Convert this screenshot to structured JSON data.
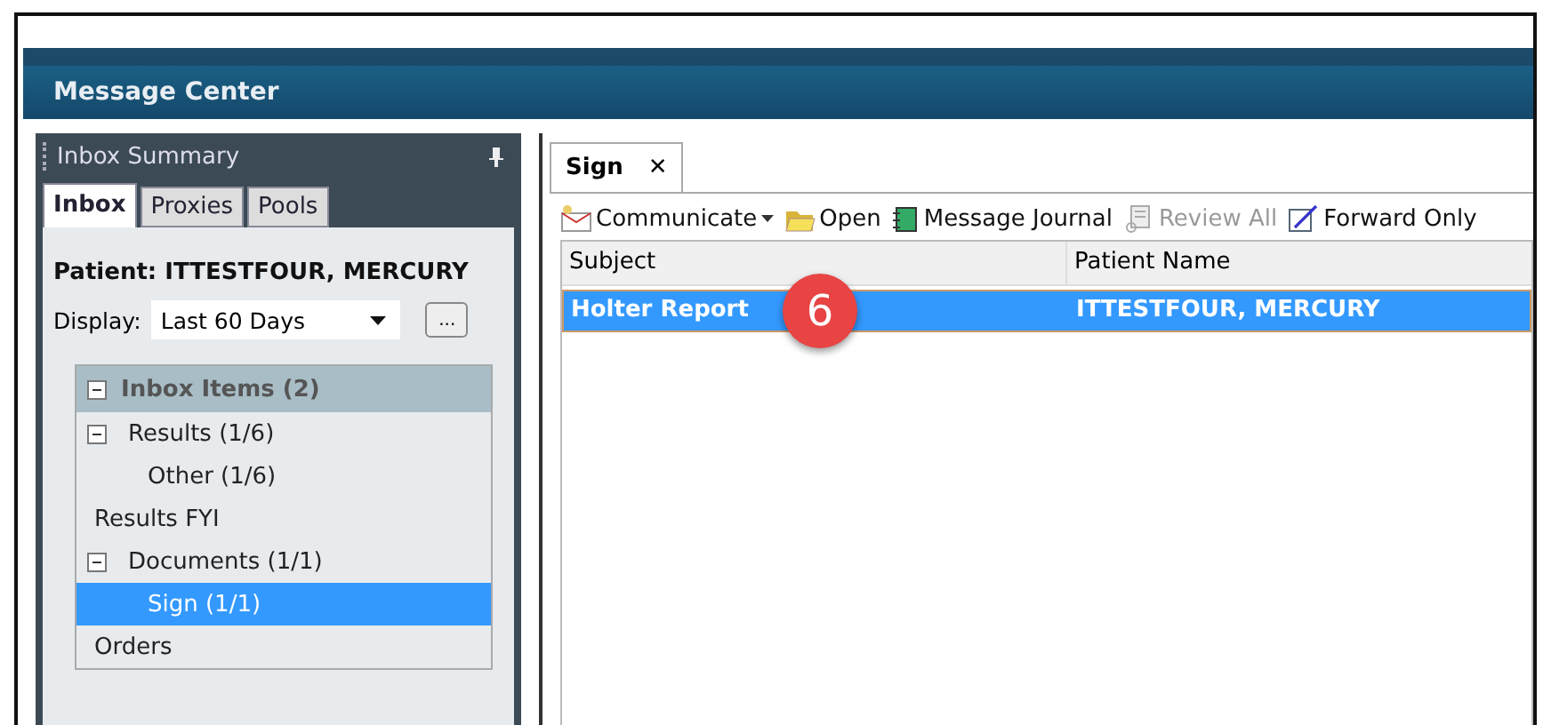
{
  "window": {
    "title": "Message Center"
  },
  "inbox_summary": {
    "title": "Inbox Summary",
    "tabs": [
      {
        "label": "Inbox",
        "selected": true
      },
      {
        "label": "Proxies",
        "selected": false
      },
      {
        "label": "Pools",
        "selected": false
      }
    ],
    "patient": "Patient: ITTESTFOUR, MERCURY",
    "display": {
      "label": "Display:",
      "value": "Last 60 Days",
      "more": "..."
    },
    "tree": {
      "label": "Inbox Items (2)",
      "expanded": true,
      "children": [
        {
          "label": "Results (1/6)",
          "expanded": true,
          "selected": false,
          "children": [
            {
              "label": "Other (1/6)",
              "selected": false
            }
          ]
        },
        {
          "label": "Results FYI",
          "selected": false
        },
        {
          "label": "Documents (1/1)",
          "expanded": true,
          "selected": false,
          "children": [
            {
              "label": "Sign (1/1)",
              "selected": true
            }
          ]
        },
        {
          "label": "Orders",
          "selected": false
        }
      ]
    }
  },
  "doc_tabs": [
    {
      "label": "Sign",
      "close": "✕",
      "selected": true
    }
  ],
  "toolbar": [
    {
      "kind": "communicate",
      "label": "Communicate",
      "dropdown": true,
      "disabled": false
    },
    {
      "kind": "open",
      "label": "Open",
      "disabled": false
    },
    {
      "kind": "journal",
      "label": "Message Journal",
      "disabled": false
    },
    {
      "kind": "review",
      "label": "Review All",
      "disabled": true
    },
    {
      "kind": "forward",
      "label": "Forward Only",
      "disabled": false
    }
  ],
  "table": {
    "columns": [
      "Subject",
      "Patient Name"
    ],
    "rows": [
      {
        "cells": [
          "Holter Report",
          "ITTESTFOUR, MERCURY"
        ],
        "selected": true
      }
    ]
  },
  "callout": "6"
}
